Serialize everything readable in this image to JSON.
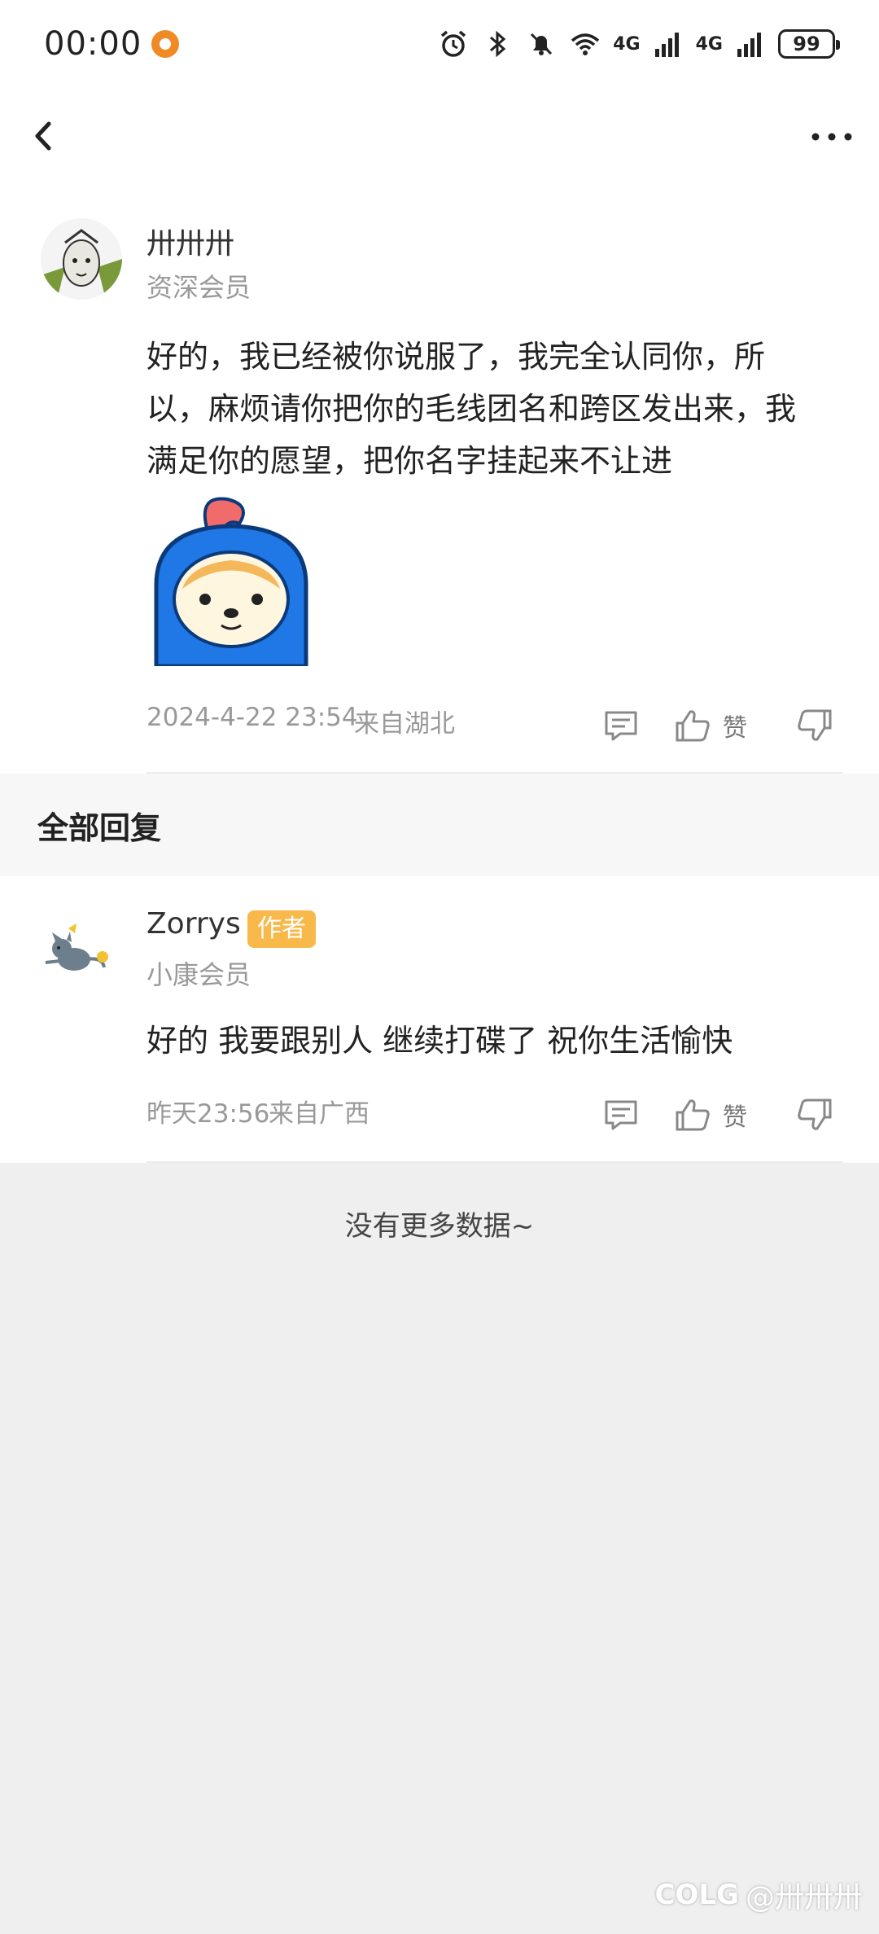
{
  "status_bar": {
    "time": "00:00",
    "network1": "4G",
    "network2": "4G",
    "battery": "99"
  },
  "main_comment": {
    "user_name": "卅卅卅",
    "user_level": "资深会员",
    "text_lines": [
      "好的，我已经被你说服了，我完全认同你，所",
      "以，麻烦请你把你的毛线团名和跨区发出来，我",
      "满足你的愿望，把你名字挂起来不让进"
    ],
    "timestamp": "2024-4-22 23:54",
    "location": "来自湖北",
    "like_label": "赞"
  },
  "section": {
    "title": "全部回复"
  },
  "reply": {
    "user_name": "Zorrys",
    "badge": "作者",
    "user_level": "小康会员",
    "text": "好的  我要跟别人 继续打碟了  祝你生活愉快",
    "timestamp": "昨天23:56",
    "location": "来自广西",
    "like_label": "赞"
  },
  "footer": {
    "no_more": "没有更多数据~"
  },
  "watermark": {
    "logo": "COLG",
    "text": "@卅卅卅"
  },
  "colors": {
    "accent_orange": "#f08a24",
    "badge": "#f8b84a",
    "sticker_blue": "#1f78e6",
    "sticker_red": "#f26b6b"
  }
}
